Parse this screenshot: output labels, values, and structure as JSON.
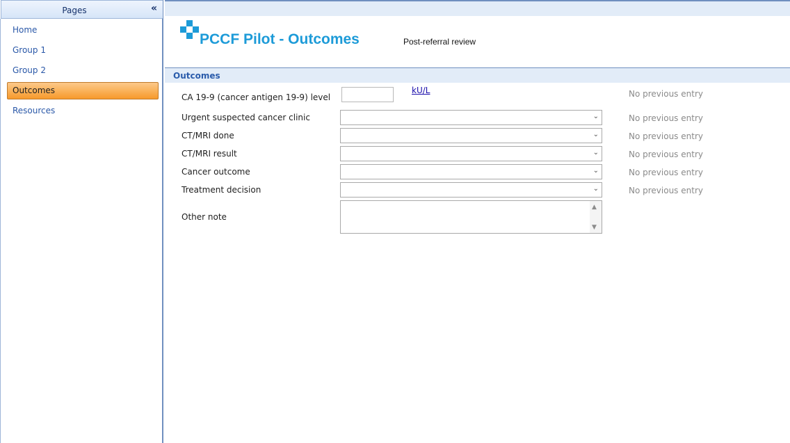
{
  "sidebar": {
    "title": "Pages",
    "collapse_icon": "«",
    "items": [
      {
        "label": "Home",
        "active": false
      },
      {
        "label": "Group 1",
        "active": false
      },
      {
        "label": "Group 2",
        "active": false
      },
      {
        "label": "Outcomes",
        "active": true
      },
      {
        "label": "Resources",
        "active": false
      }
    ]
  },
  "header": {
    "logo_icon": "pccf-logo-icon",
    "title": "PCCF Pilot - Outcomes",
    "subtitle": "Post-referral review"
  },
  "section": {
    "title": "Outcomes"
  },
  "form": {
    "ca19_9": {
      "label": "CA 19-9 (cancer antigen 19-9) level",
      "value": "",
      "unit": "kU/L",
      "previous": "No previous entry"
    },
    "fields": [
      {
        "label": "Urgent suspected cancer clinic",
        "value": "",
        "previous": "No previous entry"
      },
      {
        "label": "CT/MRI done",
        "value": "",
        "previous": "No previous entry"
      },
      {
        "label": "CT/MRI result",
        "value": "",
        "previous": "No previous entry"
      },
      {
        "label": "Cancer outcome",
        "value": "",
        "previous": "No previous entry"
      },
      {
        "label": "Treatment decision",
        "value": "",
        "previous": "No previous entry"
      }
    ],
    "other_note": {
      "label": "Other note",
      "value": ""
    }
  },
  "colors": {
    "accent": "#1d9bd8",
    "active_nav": "#f79a2b",
    "section_bar": "#e2ecf8"
  }
}
